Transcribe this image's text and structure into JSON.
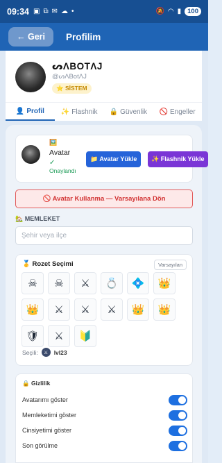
{
  "status": {
    "time": "09:34",
    "battery": "100"
  },
  "appbar": {
    "back_label": "← Geri",
    "title": "Profilim"
  },
  "profile": {
    "username": "ᔕΛBOTΛJ",
    "handle": "@ᔕΛBotΛJ",
    "badge": "⭐ SİSTEM"
  },
  "tabs": [
    {
      "icon": "👤",
      "label": "Profil"
    },
    {
      "icon": "✨",
      "label": "Flashnik"
    },
    {
      "icon": "🔒",
      "label": "Güvenlik"
    },
    {
      "icon": "🚫",
      "label": "Engeller"
    }
  ],
  "avatar_section": {
    "emoji": "🖼️",
    "label": "Avatar",
    "check": "✓",
    "status": "Onaylandı",
    "upload_button": "📁 Avatar Yükle",
    "flashnik_button": "✨ Flashnik Yükle",
    "remove_button": "🚫 Avatar Kullanma — Varsayılana Dön"
  },
  "hometown": {
    "label": "🏡 MEMLEKET",
    "placeholder": "Şehir veya ilçe",
    "value": ""
  },
  "badges": {
    "title": "🥇 Rozet Seçimi",
    "default_button": "Varsayılan",
    "items": [
      {
        "icon": "skull-swords-icon",
        "glyph": "☠"
      },
      {
        "icon": "skull-swords-icon",
        "glyph": "☠"
      },
      {
        "icon": "shield-swords-icon",
        "glyph": "⚔"
      },
      {
        "icon": "diamond-ring-icon",
        "glyph": "💍"
      },
      {
        "icon": "blue-gem-icon",
        "glyph": "💠"
      },
      {
        "icon": "tiara-icon",
        "glyph": "👑"
      },
      {
        "icon": "purple-crown-icon",
        "glyph": "👑"
      },
      {
        "icon": "shield-swords-icon",
        "glyph": "⚔"
      },
      {
        "icon": "shield-swords-icon",
        "glyph": "⚔"
      },
      {
        "icon": "shield-swords-icon",
        "glyph": "⚔"
      },
      {
        "icon": "gold-crown-icon",
        "glyph": "👑"
      },
      {
        "icon": "gold-crown-icon",
        "glyph": "👑"
      },
      {
        "icon": "emblem-icon",
        "glyph": "🛡"
      },
      {
        "icon": "shield-swords-icon",
        "glyph": "⚔"
      },
      {
        "icon": "blue-emblem-icon",
        "glyph": "🔰"
      }
    ],
    "selected_label": "Seçili:",
    "selected_value": "lvl23"
  },
  "privacy": {
    "title": "🔒 Gizlilik",
    "rows": [
      {
        "label": "Avatarımı göster",
        "on": true
      },
      {
        "label": "Memleketimi göster",
        "on": true
      },
      {
        "label": "Cinsiyetimi göster",
        "on": true
      },
      {
        "label": "Son görülme",
        "on": true
      }
    ]
  },
  "colors": {
    "primary": "#1f64b5",
    "statusbar": "#174f92",
    "upload": "#2563d9",
    "flashnik": "#7a35d6",
    "danger": "#d23434",
    "toggle": "#1d6fe0"
  }
}
